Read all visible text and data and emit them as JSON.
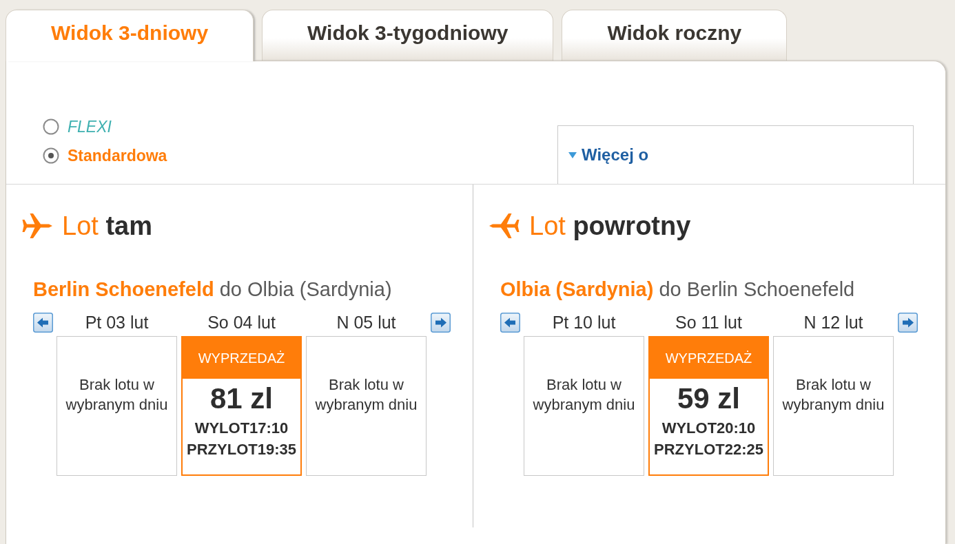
{
  "tabs": [
    {
      "label": "Widok 3-dniowy",
      "selected": true
    },
    {
      "label": "Widok 3-tygodniowy",
      "selected": false
    },
    {
      "label": "Widok roczny",
      "selected": false
    }
  ],
  "fare_options": [
    {
      "label": "FLEXI",
      "kind": "flexi",
      "selected": false
    },
    {
      "label": "Standardowa",
      "kind": "standard",
      "selected": true
    }
  ],
  "info_box": {
    "link": "Więcej o"
  },
  "flights": [
    {
      "kind": "outbound",
      "heading": "Lot **tam**",
      "route": "**Berlin Schoenefeld** do Olbia (Sardynia)",
      "days": [
        {
          "date": "Pt 03 lut",
          "kind": "empty",
          "selected": false,
          "text": "Brak lotu w wybranym dniu"
        },
        {
          "date": "So 04 lut",
          "kind": "fare",
          "selected": true,
          "badge": "WYPRZEDAŻ",
          "price": "81 zl",
          "departure": "WYLOT17:10",
          "arrival": "PRZYLOT19:35"
        },
        {
          "date": "N 05 lut",
          "kind": "empty",
          "selected": false,
          "text": "Brak lotu w wybranym dniu"
        }
      ]
    },
    {
      "kind": "return",
      "heading": "Lot **powrotny**",
      "route": "**Olbia (Sardynia)** do Berlin Schoenefeld",
      "days": [
        {
          "date": "Pt 10 lut",
          "kind": "empty",
          "selected": false,
          "text": "Brak lotu w wybranym dniu"
        },
        {
          "date": "So 11 lut",
          "kind": "fare",
          "selected": true,
          "badge": "WYPRZEDAŻ",
          "price": "59 zl",
          "departure": "WYLOT20:10",
          "arrival": "PRZYLOT22:25"
        },
        {
          "date": "N 12 lut",
          "kind": "empty",
          "selected": false,
          "text": "Brak lotu w wybranym dniu"
        }
      ]
    }
  ]
}
